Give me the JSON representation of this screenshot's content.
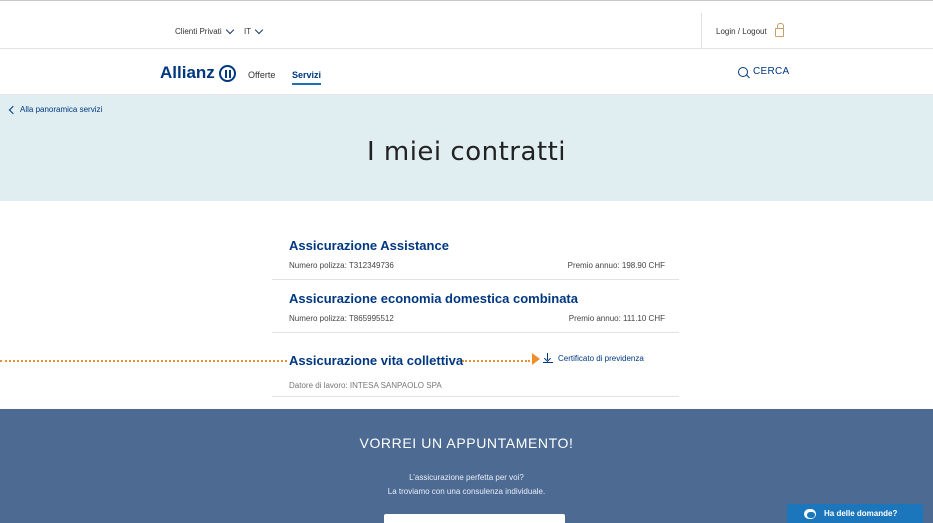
{
  "topbar": {
    "segment_label": "Clienti Privati",
    "language_label": "IT",
    "login_label": "Login / Logout"
  },
  "nav": {
    "logo_text": "Allianz",
    "offerte_label": "Offerte",
    "servizi_label": "Servizi",
    "search_label": "CERCA"
  },
  "hero": {
    "back_label": "Alla panoramica servizi",
    "title": "I miei contratti"
  },
  "contracts": [
    {
      "title": "Assicurazione Assistance",
      "number": "Numero polizza: T312349736",
      "premium": "Premio annuo: 198.90 CHF"
    },
    {
      "title": "Assicurazione economia domestica combinata",
      "number": "Numero polizza: T865995512",
      "premium": "Premio annuo: 111.10 CHF"
    },
    {
      "title": "Assicurazione vita collettiva",
      "number": "Datore di lavoro: INTESA SANPAOLO SPA",
      "download_label": "Certificato di previdenza"
    }
  ],
  "footer": {
    "title": "VORREI UN APPUNTAMENTO!",
    "line1": "L’assicurazione perfetta per voi?",
    "line2": "La troviamo con una consulenza individuale.",
    "chat_label": "Ha delle domande?"
  },
  "colors": {
    "brand": "#003781",
    "hero_bg": "#e0eef1",
    "highlight": "#f08e2a",
    "footer_bg": "#4c6a92",
    "chat_bg": "#1b76bc"
  }
}
